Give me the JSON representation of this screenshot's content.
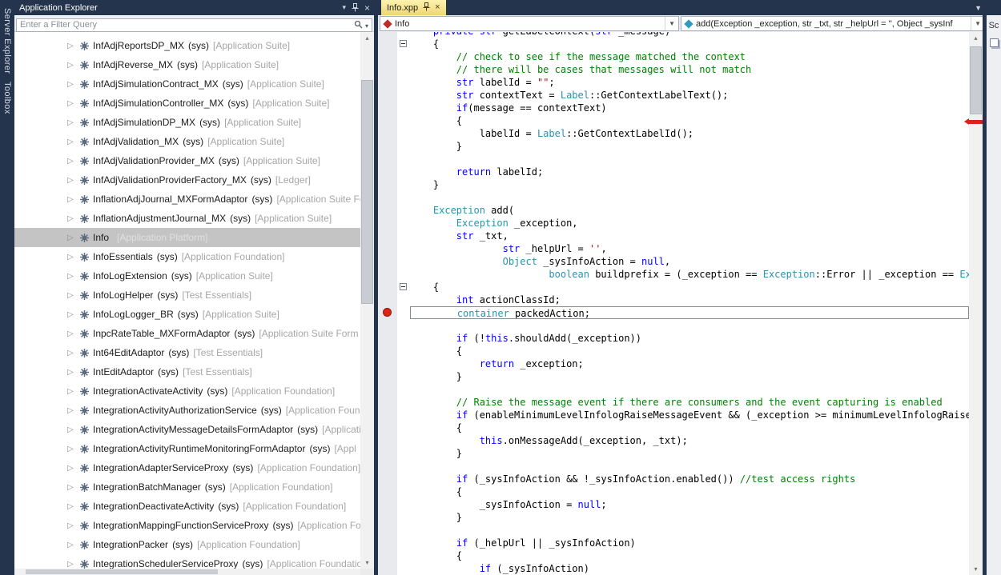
{
  "left_strip": {
    "server_explorer_label": "Server Explorer",
    "toolbox_label": "Toolbox"
  },
  "explorer": {
    "title": "Application Explorer",
    "filter_placeholder": "Enter a Filter Query",
    "items": [
      {
        "name": "InfAdjReportsDP_MX",
        "sys": "(sys)",
        "model": "[Application Suite]"
      },
      {
        "name": "InfAdjReverse_MX",
        "sys": "(sys)",
        "model": "[Application Suite]"
      },
      {
        "name": "InfAdjSimulationContract_MX",
        "sys": "(sys)",
        "model": "[Application Suite]"
      },
      {
        "name": "InfAdjSimulationController_MX",
        "sys": "(sys)",
        "model": "[Application Suite]"
      },
      {
        "name": "InfAdjSimulationDP_MX",
        "sys": "(sys)",
        "model": "[Application Suite]"
      },
      {
        "name": "InfAdjValidation_MX",
        "sys": "(sys)",
        "model": "[Application Suite]"
      },
      {
        "name": "InfAdjValidationProvider_MX",
        "sys": "(sys)",
        "model": "[Application Suite]"
      },
      {
        "name": "InfAdjValidationProviderFactory_MX",
        "sys": "(sys)",
        "model": "[Ledger]"
      },
      {
        "name": "InflationAdjJournal_MXFormAdaptor",
        "sys": "(sys)",
        "model": "[Application Suite Fo"
      },
      {
        "name": "InflationAdjustmentJournal_MX",
        "sys": "(sys)",
        "model": "[Application Suite]"
      },
      {
        "name": "Info",
        "sys": "",
        "model": "[Application Platform]",
        "selected": true
      },
      {
        "name": "InfoEssentials",
        "sys": "(sys)",
        "model": "[Application Foundation]"
      },
      {
        "name": "InfoLogExtension",
        "sys": "(sys)",
        "model": "[Application Suite]"
      },
      {
        "name": "InfoLogHelper",
        "sys": "(sys)",
        "model": "[Test Essentials]"
      },
      {
        "name": "InfoLogLogger_BR",
        "sys": "(sys)",
        "model": "[Application Suite]"
      },
      {
        "name": "InpcRateTable_MXFormAdaptor",
        "sys": "(sys)",
        "model": "[Application Suite Form A"
      },
      {
        "name": "Int64EditAdaptor",
        "sys": "(sys)",
        "model": "[Test Essentials]"
      },
      {
        "name": "IntEditAdaptor",
        "sys": "(sys)",
        "model": "[Test Essentials]"
      },
      {
        "name": "IntegrationActivateActivity",
        "sys": "(sys)",
        "model": "[Application Foundation]"
      },
      {
        "name": "IntegrationActivityAuthorizationService",
        "sys": "(sys)",
        "model": "[Application Foun"
      },
      {
        "name": "IntegrationActivityMessageDetailsFormAdaptor",
        "sys": "(sys)",
        "model": "[Applicati"
      },
      {
        "name": "IntegrationActivityRuntimeMonitoringFormAdaptor",
        "sys": "(sys)",
        "model": "[Appl"
      },
      {
        "name": "IntegrationAdapterServiceProxy",
        "sys": "(sys)",
        "model": "[Application Foundation]"
      },
      {
        "name": "IntegrationBatchManager",
        "sys": "(sys)",
        "model": "[Application Foundation]"
      },
      {
        "name": "IntegrationDeactivateActivity",
        "sys": "(sys)",
        "model": "[Application Foundation]"
      },
      {
        "name": "IntegrationMappingFunctionServiceProxy",
        "sys": "(sys)",
        "model": "[Application Fo"
      },
      {
        "name": "IntegrationPacker",
        "sys": "(sys)",
        "model": "[Application Foundation]"
      },
      {
        "name": "IntegrationSchedulerServiceProxy",
        "sys": "(sys)",
        "model": "[Application Foundation]"
      }
    ]
  },
  "editor": {
    "tab_label": "Info.xpp",
    "type_dropdown": "Info",
    "member_dropdown": "add(Exception _exception, str _txt, str _helpUrl = '', Object _sysInf",
    "code_lines": [
      {
        "s": [
          [
            "p",
            "    "
          ],
          [
            "k",
            "private"
          ],
          [
            "p",
            " "
          ],
          [
            "k",
            "str"
          ],
          [
            "p",
            " getLabelContext("
          ],
          [
            "k",
            "str"
          ],
          [
            "p",
            " _message)"
          ]
        ]
      },
      {
        "s": [
          [
            "p",
            "    {"
          ]
        ],
        "fold": true
      },
      {
        "s": [
          [
            "c",
            "        // check to see if the message matched the context"
          ]
        ]
      },
      {
        "s": [
          [
            "c",
            "        // there will be cases that messages will not match"
          ]
        ]
      },
      {
        "s": [
          [
            "p",
            "        "
          ],
          [
            "k",
            "str"
          ],
          [
            "p",
            " labelId = "
          ],
          [
            "s",
            "\"\""
          ],
          [
            "p",
            ";"
          ]
        ]
      },
      {
        "s": [
          [
            "p",
            "        "
          ],
          [
            "k",
            "str"
          ],
          [
            "p",
            " contextText = "
          ],
          [
            "t",
            "Label"
          ],
          [
            "p",
            "::GetContextLabelText();"
          ]
        ]
      },
      {
        "s": [
          [
            "p",
            "        "
          ],
          [
            "k",
            "if"
          ],
          [
            "p",
            "(message == contextText)"
          ]
        ]
      },
      {
        "s": [
          [
            "p",
            "        {"
          ]
        ]
      },
      {
        "s": [
          [
            "p",
            "            labelId = "
          ],
          [
            "t",
            "Label"
          ],
          [
            "p",
            "::GetContextLabelId();"
          ]
        ]
      },
      {
        "s": [
          [
            "p",
            "        }"
          ]
        ]
      },
      {
        "s": []
      },
      {
        "s": [
          [
            "p",
            "        "
          ],
          [
            "k",
            "return"
          ],
          [
            "p",
            " labelId;"
          ]
        ]
      },
      {
        "s": [
          [
            "p",
            "    }"
          ]
        ]
      },
      {
        "s": []
      },
      {
        "s": [
          [
            "p",
            "    "
          ],
          [
            "t",
            "Exception"
          ],
          [
            "p",
            " add("
          ]
        ]
      },
      {
        "s": [
          [
            "p",
            "        "
          ],
          [
            "t",
            "Exception"
          ],
          [
            "p",
            " _exception,"
          ]
        ]
      },
      {
        "s": [
          [
            "p",
            "        "
          ],
          [
            "k",
            "str"
          ],
          [
            "p",
            " _txt,"
          ]
        ]
      },
      {
        "s": [
          [
            "p",
            "                "
          ],
          [
            "k",
            "str"
          ],
          [
            "p",
            " _helpUrl = "
          ],
          [
            "s",
            "''"
          ],
          [
            "p",
            ","
          ]
        ]
      },
      {
        "s": [
          [
            "p",
            "                "
          ],
          [
            "t",
            "Object"
          ],
          [
            "p",
            " _sysInfoAction = "
          ],
          [
            "k",
            "null"
          ],
          [
            "p",
            ","
          ]
        ]
      },
      {
        "s": [
          [
            "p",
            "                        "
          ],
          [
            "t",
            "boolean"
          ],
          [
            "p",
            " buildprefix = (_exception == "
          ],
          [
            "t",
            "Exception"
          ],
          [
            "p",
            "::Error || _exception == "
          ],
          [
            "t",
            "Exce"
          ]
        ]
      },
      {
        "s": [
          [
            "p",
            "    {"
          ]
        ],
        "fold": true
      },
      {
        "s": [
          [
            "p",
            "        "
          ],
          [
            "k",
            "int"
          ],
          [
            "p",
            " actionClassId;"
          ]
        ]
      },
      {
        "s": [
          [
            "p",
            "        "
          ],
          [
            "t",
            "container"
          ],
          [
            "p",
            " packedAction;"
          ]
        ],
        "bp": true,
        "box": true
      },
      {
        "s": []
      },
      {
        "s": [
          [
            "p",
            "        "
          ],
          [
            "k",
            "if"
          ],
          [
            "p",
            " (!"
          ],
          [
            "k",
            "this"
          ],
          [
            "p",
            ".shouldAdd(_exception))"
          ]
        ]
      },
      {
        "s": [
          [
            "p",
            "        {"
          ]
        ]
      },
      {
        "s": [
          [
            "p",
            "            "
          ],
          [
            "k",
            "return"
          ],
          [
            "p",
            " _exception;"
          ]
        ]
      },
      {
        "s": [
          [
            "p",
            "        }"
          ]
        ]
      },
      {
        "s": []
      },
      {
        "s": [
          [
            "c",
            "        // Raise the message event if there are consumers and the event capturing is enabled"
          ]
        ]
      },
      {
        "s": [
          [
            "p",
            "        "
          ],
          [
            "k",
            "if"
          ],
          [
            "p",
            " (enableMinimumLevelInfologRaiseMessageEvent && (_exception >= minimumLevelInfologRaiseMes"
          ]
        ]
      },
      {
        "s": [
          [
            "p",
            "        {"
          ]
        ]
      },
      {
        "s": [
          [
            "p",
            "            "
          ],
          [
            "k",
            "this"
          ],
          [
            "p",
            ".onMessageAdd(_exception, _txt);"
          ]
        ]
      },
      {
        "s": [
          [
            "p",
            "        }"
          ]
        ]
      },
      {
        "s": []
      },
      {
        "s": [
          [
            "p",
            "        "
          ],
          [
            "k",
            "if"
          ],
          [
            "p",
            " (_sysInfoAction && !_sysInfoAction.enabled()) "
          ],
          [
            "c",
            "//test access rights"
          ]
        ]
      },
      {
        "s": [
          [
            "p",
            "        {"
          ]
        ]
      },
      {
        "s": [
          [
            "p",
            "            _sysInfoAction = "
          ],
          [
            "k",
            "null"
          ],
          [
            "p",
            ";"
          ]
        ]
      },
      {
        "s": [
          [
            "p",
            "        }"
          ]
        ]
      },
      {
        "s": []
      },
      {
        "s": [
          [
            "p",
            "        "
          ],
          [
            "k",
            "if"
          ],
          [
            "p",
            " (_helpUrl || _sysInfoAction)"
          ]
        ]
      },
      {
        "s": [
          [
            "p",
            "        {"
          ]
        ]
      },
      {
        "s": [
          [
            "p",
            "            "
          ],
          [
            "k",
            "if"
          ],
          [
            "p",
            " (_sysInfoAction)"
          ]
        ]
      }
    ]
  },
  "right_strip": {
    "label": "Sc"
  },
  "colors": {
    "frame": "#24344d",
    "active_tab": "#f3db79",
    "tree_selection": "#c4c4c4",
    "keyword": "#0000ff",
    "type": "#2b91af",
    "comment": "#008000",
    "string": "#a31515",
    "breakpoint": "#e0240f"
  }
}
